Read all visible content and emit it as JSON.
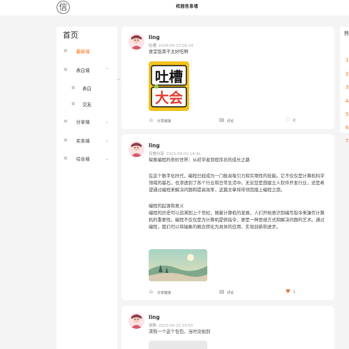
{
  "header": {
    "logo_glyph": "信",
    "brand": "校园信息墙"
  },
  "sidebar": {
    "title": "首页",
    "items": [
      {
        "label": "最新墙",
        "icon": "gear-icon",
        "active": true
      },
      {
        "label": "表白墙",
        "icon": "gear-icon",
        "expanded": true
      },
      {
        "label": "表白",
        "icon": "gear-icon",
        "sub": true
      },
      {
        "label": "交友",
        "icon": "gear-icon",
        "sub": true
      },
      {
        "label": "分享墙",
        "icon": "gear-icon"
      },
      {
        "label": "买卖墙",
        "icon": "gear-icon"
      },
      {
        "label": "综合墙",
        "icon": "gear-icon"
      }
    ]
  },
  "posts": [
    {
      "user": "ling",
      "category": "吐槽",
      "time": "2024-04-10 09:24",
      "text": "食堂饭菜不太好吃啊",
      "image": "吐槽大会 sticker",
      "actions": {
        "share": "分享链接",
        "comment": "评论",
        "likes": "0",
        "liked": false
      }
    },
    {
      "user": "ling",
      "category": "日常分享",
      "time": "2023-09-03 14:41",
      "paragraphs": [
        "探索编程的奇妙世界：从初学者到程序员的成长之路",
        "在这个数字化时代，编程已经成为一门极具吸引力和实用性的技能。它不仅仅是计算机科学领域的基石，也渗透到了各个行业和日常生活中。无论您是想建立人软件开发行业，还是希望通过编程来解决问题和提高效率，这篇文章将带领您踏上编程之旅。",
        "编程的起源和意义",
        "编程的历史可以追溯到上个世纪，随着计算机的发展，人们开始意识到编写指令来操作计算机的重要性。编程不仅仅是为计算机提供指令，更是一种思维方式和解决问题的艺术。通过编程，我们可以将抽象的概念转化为具体的应用，实现创新和进步。"
      ],
      "image": "landscape illustration",
      "actions": {
        "share": "分享链接",
        "comment": "评论",
        "likes": "1",
        "liked": true
      }
    },
    {
      "user": "ling",
      "category": "求购",
      "time": "2023-04-22 19:55",
      "text": "求购一个这个包包，当时没拍到"
    }
  ],
  "right_panel": {
    "title": "热",
    "ranks": [
      "1",
      "2",
      "3",
      "4",
      "5",
      "6",
      "7"
    ]
  },
  "colors": {
    "accent": "#ff6a00",
    "like": "#e8743b"
  }
}
